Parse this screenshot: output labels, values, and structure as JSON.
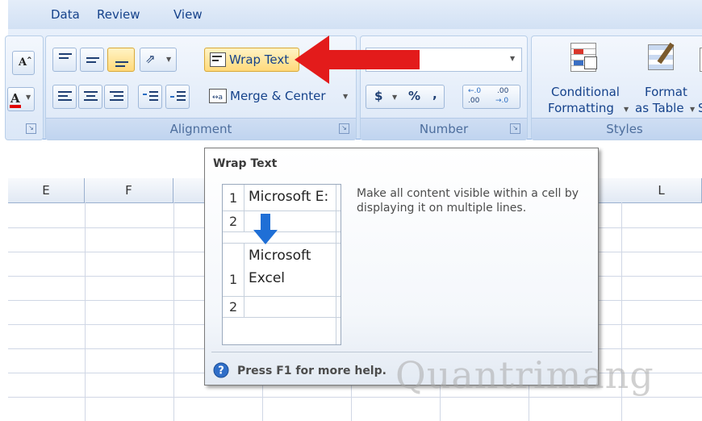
{
  "menu": {
    "tabs": [
      "Data",
      "Review",
      "View"
    ]
  },
  "ribbon": {
    "alignment": {
      "label": "Alignment",
      "wrap_text": "Wrap Text",
      "merge_center": "Merge & Center"
    },
    "number": {
      "label": "Number",
      "currency": "$",
      "percent": "%",
      "comma": ",",
      "increase_decimal": ".00",
      "decrease_decimal": ".00"
    },
    "styles": {
      "label": "Styles",
      "conditional_formatting_line1": "Conditional",
      "conditional_formatting_line2": "Formatting",
      "format_table_line1": "Format",
      "format_table_line2": "as Table",
      "cell_styles_partial": "S"
    }
  },
  "grid": {
    "columns": [
      "E",
      "F",
      "L"
    ]
  },
  "tooltip": {
    "title": "Wrap Text",
    "description": "Make all content visible within a cell by displaying it on multiple lines.",
    "example": {
      "before_row1_num": "1",
      "before_row1_text": "Microsoft E:",
      "before_row2_num": "2",
      "after_line1": "Microsoft",
      "after_row1_num": "1",
      "after_line2": "Excel",
      "after_row2_num": "2"
    },
    "help": "Press F1 for more help."
  },
  "watermark": "Quantrimang",
  "colors": {
    "accent_arrow": "#e31b1b",
    "example_arrow": "#1f6fd6",
    "ribbon_text": "#15428b"
  }
}
